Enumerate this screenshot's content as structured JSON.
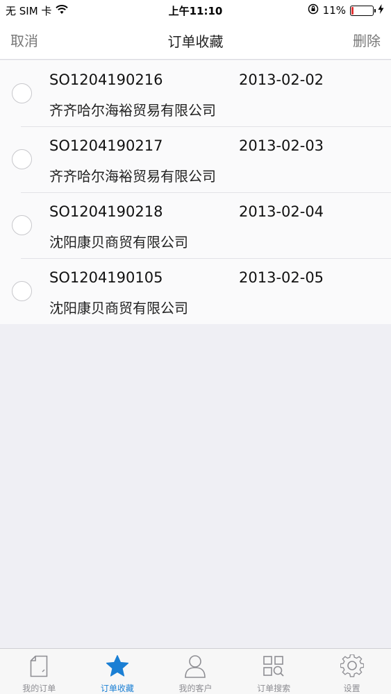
{
  "status_bar": {
    "carrier": "无 SIM 卡",
    "time": "上午11:10",
    "battery_percent": "11%",
    "battery_level": 0.11,
    "icons": [
      "wifi-icon",
      "orientation-lock-icon",
      "battery-icon",
      "charging-icon"
    ]
  },
  "nav": {
    "cancel_label": "取消",
    "title": "订单收藏",
    "delete_label": "删除"
  },
  "orders": [
    {
      "code": "SO1204190216",
      "date": "2013-02-02",
      "company": "齐齐哈尔海裕贸易有限公司",
      "selected": false
    },
    {
      "code": "SO1204190217",
      "date": "2013-02-03",
      "company": "齐齐哈尔海裕贸易有限公司",
      "selected": false
    },
    {
      "code": "SO1204190218",
      "date": "2013-02-04",
      "company": "沈阳康贝商贸有限公司",
      "selected": false
    },
    {
      "code": "SO1204190105",
      "date": "2013-02-05",
      "company": "沈阳康贝商贸有限公司",
      "selected": false
    }
  ],
  "tabs": [
    {
      "label": "我的订单",
      "icon": "document-icon",
      "active": false
    },
    {
      "label": "订单收藏",
      "icon": "star-icon",
      "active": true
    },
    {
      "label": "我的客户",
      "icon": "person-icon",
      "active": false
    },
    {
      "label": "订单搜索",
      "icon": "search-grid-icon",
      "active": false
    },
    {
      "label": "设置",
      "icon": "gear-icon",
      "active": false
    }
  ],
  "colors": {
    "accent": "#1a7fd4",
    "inactive": "#8e8e93",
    "battery_low": "#e33333"
  }
}
